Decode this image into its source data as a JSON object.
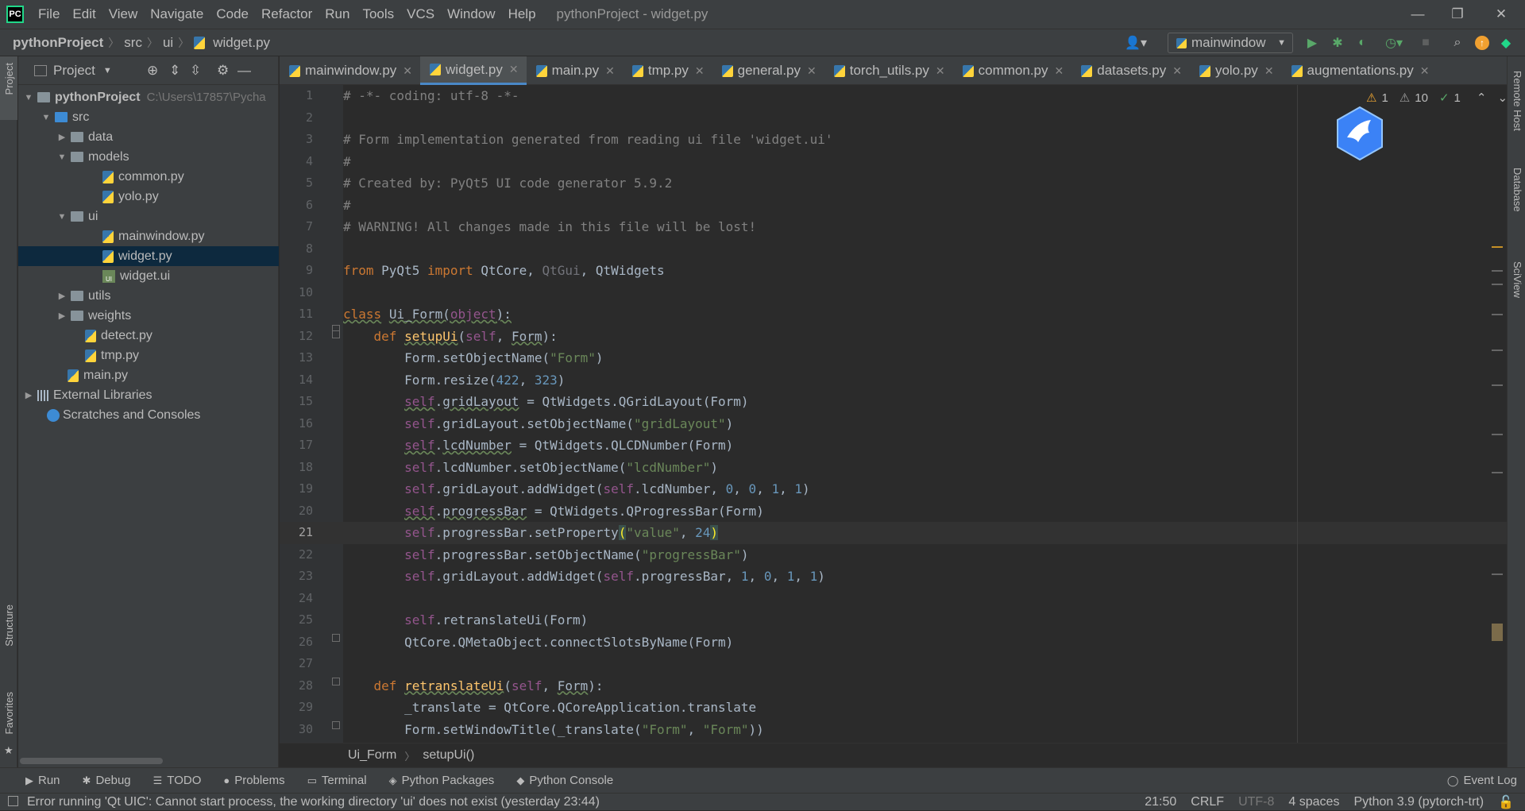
{
  "window": {
    "title": "pythonProject - widget.py"
  },
  "menu": [
    {
      "label": "File"
    },
    {
      "label": "Edit"
    },
    {
      "label": "View"
    },
    {
      "label": "Navigate"
    },
    {
      "label": "Code"
    },
    {
      "label": "Refactor"
    },
    {
      "label": "Run"
    },
    {
      "label": "Tools"
    },
    {
      "label": "VCS"
    },
    {
      "label": "Window"
    },
    {
      "label": "Help"
    }
  ],
  "breadcrumb": {
    "project": "pythonProject",
    "folder1": "src",
    "folder2": "ui",
    "file": "widget.py"
  },
  "run_config": {
    "name": "mainwindow"
  },
  "left_strip": {
    "project": "Project",
    "structure": "Structure",
    "favorites": "Favorites"
  },
  "right_strip": {
    "remote": "Remote Host",
    "database": "Database",
    "sciview": "SciView"
  },
  "project_panel": {
    "title": "Project",
    "tree": [
      {
        "label": "pythonProject",
        "extra": "C:\\Users\\17857\\Pycha",
        "type": "folder",
        "bold": true
      },
      {
        "label": "src",
        "type": "folder-blue"
      },
      {
        "label": "data",
        "type": "folder"
      },
      {
        "label": "models",
        "type": "folder"
      },
      {
        "label": "common.py",
        "type": "py"
      },
      {
        "label": "yolo.py",
        "type": "py"
      },
      {
        "label": "ui",
        "type": "folder"
      },
      {
        "label": "mainwindow.py",
        "type": "py"
      },
      {
        "label": "widget.py",
        "type": "py"
      },
      {
        "label": "widget.ui",
        "type": "ui"
      },
      {
        "label": "utils",
        "type": "folder"
      },
      {
        "label": "weights",
        "type": "folder"
      },
      {
        "label": "detect.py",
        "type": "py"
      },
      {
        "label": "tmp.py",
        "type": "py"
      },
      {
        "label": "main.py",
        "type": "py"
      },
      {
        "label": "External Libraries",
        "type": "lib"
      },
      {
        "label": "Scratches and Consoles",
        "type": "scratch"
      }
    ]
  },
  "tabs": [
    {
      "label": "mainwindow.py"
    },
    {
      "label": "widget.py"
    },
    {
      "label": "main.py"
    },
    {
      "label": "tmp.py"
    },
    {
      "label": "general.py"
    },
    {
      "label": "torch_utils.py"
    },
    {
      "label": "common.py"
    },
    {
      "label": "datasets.py"
    },
    {
      "label": "yolo.py"
    },
    {
      "label": "augmentations.py"
    }
  ],
  "inspections": {
    "warn1": "1",
    "warn2": "10",
    "ok": "1"
  },
  "line_numbers": [
    "1",
    "2",
    "3",
    "4",
    "5",
    "6",
    "7",
    "8",
    "9",
    "10",
    "11",
    "12",
    "13",
    "14",
    "15",
    "16",
    "17",
    "18",
    "19",
    "20",
    "21",
    "22",
    "23",
    "24",
    "25",
    "26",
    "27",
    "28",
    "29",
    "30"
  ],
  "current_line": "21",
  "code_breadcrumb": {
    "class": "Ui_Form",
    "method": "setupUi()"
  },
  "tool_windows": [
    {
      "label": "Run",
      "icon": "▶"
    },
    {
      "label": "Debug",
      "icon": "✱"
    },
    {
      "label": "TODO",
      "icon": "☰"
    },
    {
      "label": "Problems",
      "icon": "●"
    },
    {
      "label": "Terminal",
      "icon": "▭"
    },
    {
      "label": "Python Packages",
      "icon": "◈"
    },
    {
      "label": "Python Console",
      "icon": "◆"
    }
  ],
  "event_log": "Event Log",
  "status": {
    "message": "Error running 'Qt UIC': Cannot start process, the working directory 'ui' does not exist (yesterday 23:44)",
    "position": "21:50",
    "line_sep": "CRLF",
    "encoding": "UTF-8",
    "indent": "4 spaces",
    "interpreter": "Python 3.9 (pytorch-trt)"
  },
  "colors": {
    "accent": "#4a88c7",
    "bg": "#2b2b2b",
    "panel": "#3c3f41",
    "selected": "#0d293e"
  }
}
